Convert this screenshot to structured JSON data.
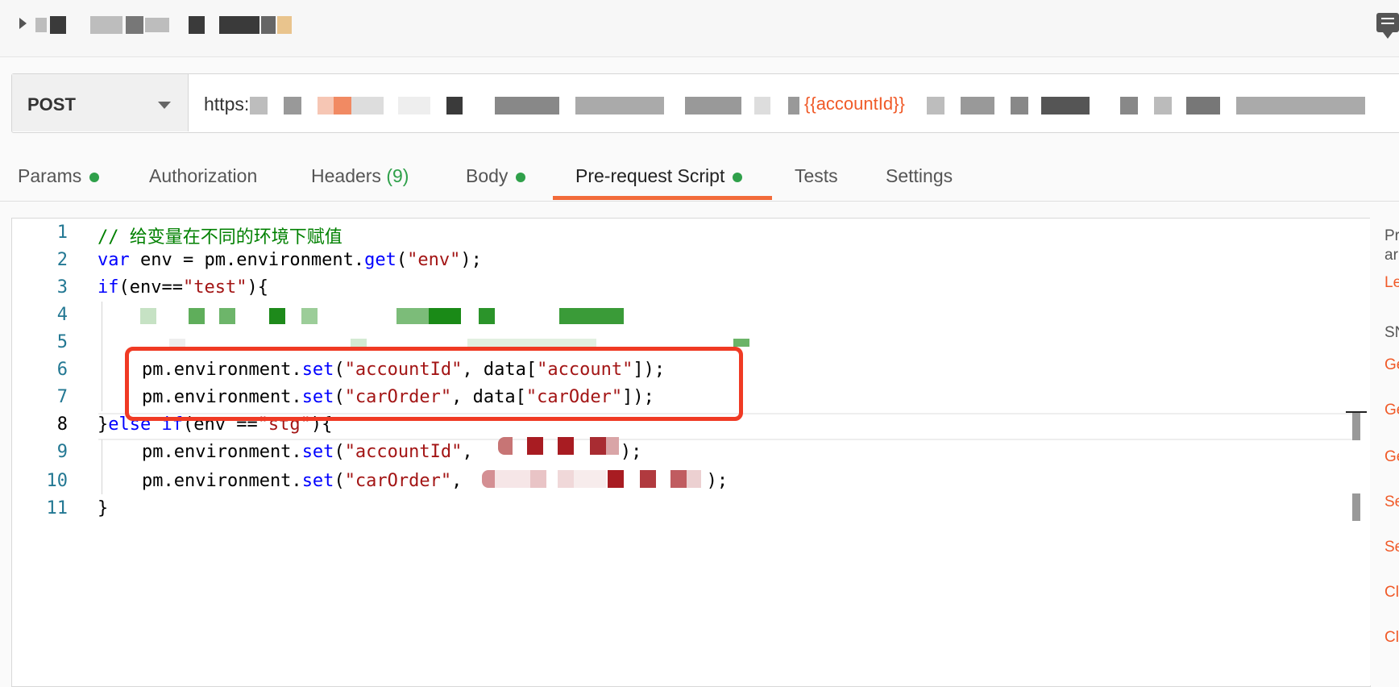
{
  "top": {
    "expand_icon": "caret-right-icon",
    "comment_icon": "comment-icon"
  },
  "request": {
    "method": "POST",
    "url_prefix": "https:",
    "url_variable": "{{accountId}}"
  },
  "tabs": [
    {
      "label": "Params",
      "dot": true
    },
    {
      "label": "Authorization"
    },
    {
      "label": "Headers",
      "count": "(9)"
    },
    {
      "label": "Body",
      "dot": true
    },
    {
      "label": "Pre-request Script",
      "dot": true,
      "active": true
    },
    {
      "label": "Tests"
    },
    {
      "label": "Settings"
    }
  ],
  "editor": {
    "line_numbers": [
      "1",
      "2",
      "3",
      "4",
      "5",
      "6",
      "7",
      "8",
      "9",
      "10",
      "11"
    ],
    "line1": {
      "comment": "// 给变量在不同的环境下赋值"
    },
    "line2": {
      "kw": "var",
      "rest1": " env = pm.environment.",
      "fn": "get",
      "p1": "(",
      "str": "\"env\"",
      "p2": ");"
    },
    "line3": {
      "kw": "if",
      "rest1": "(env==",
      "str": "\"test\"",
      "p2": "){"
    },
    "line6": {
      "a": "pm.environment.",
      "fn": "set",
      "b": "(",
      "s1": "\"accountId\"",
      "c": ", data[",
      "s2": "\"account\"",
      "d": "]);"
    },
    "line7": {
      "a": "pm.environment.",
      "fn": "set",
      "b": "(",
      "s1": "\"carOrder\"",
      "c": ", data[",
      "s2": "\"carOder\"",
      "d": "]);"
    },
    "line8": {
      "a": "}",
      "kw": "else if",
      "b": "(env ==",
      "s1": "\"stg\"",
      "c": "){"
    },
    "line9": {
      "a": "pm.environment.",
      "fn": "set",
      "b": "(",
      "s1": "\"accountId\"",
      "c": ", ",
      "d": ");"
    },
    "line10": {
      "a": "pm.environment.",
      "fn": "set",
      "b": "(",
      "s1": "\"carOrder\"",
      "c": ", ",
      "d": ");"
    },
    "line11": {
      "a": "}"
    }
  },
  "right_panel": {
    "items": [
      {
        "text": "Pr",
        "style": "gray"
      },
      {
        "text": "ar",
        "style": "gray"
      },
      {
        "text": "Le",
        "style": "orange"
      },
      {
        "text": "SN",
        "style": "gray"
      },
      {
        "text": "Ge",
        "style": "orange"
      },
      {
        "text": "Ge",
        "style": "orange"
      },
      {
        "text": "Ge",
        "style": "orange"
      },
      {
        "text": "Se",
        "style": "orange"
      },
      {
        "text": "Se",
        "style": "orange"
      },
      {
        "text": "Cl",
        "style": "orange"
      },
      {
        "text": "Cl",
        "style": "orange"
      }
    ]
  },
  "colors": {
    "accent": "#f26b3a",
    "status_dot": "#2fa04a",
    "highlight_box": "#f03a24"
  }
}
